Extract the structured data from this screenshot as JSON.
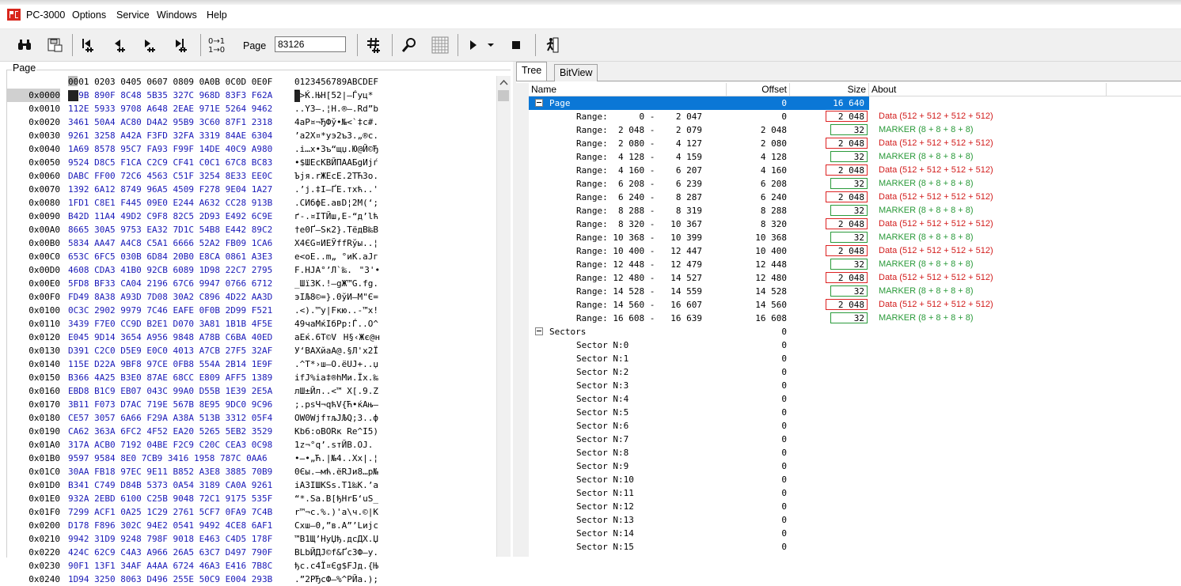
{
  "app": {
    "title": "PC-3000"
  },
  "menu": [
    "Options",
    "Service",
    "Windows",
    "Help"
  ],
  "toolbar": {
    "page_label": "Page",
    "page_value": "83126",
    "icons": [
      "binoculars-icon",
      "save-icon",
      "first-page-icon",
      "prev-page-icon",
      "next-page-icon",
      "last-page-icon",
      "swap-bits-icon",
      "page-number-field",
      "hash-icon",
      "magnifier-icon",
      "grid-icon",
      "play-icon",
      "dropdown-arrow-icon",
      "stop-icon",
      "exit-icon"
    ]
  },
  "hex": {
    "group_label": "Page",
    "header_hex": "0001 0203 0405 0607 0809 0A0B 0C0D 0E0F",
    "header_ascii": "0123456789ABCDEF",
    "rows": [
      {
        "addr": "0x0000",
        "hex": "E59B 890F 8C48 5B35 327C 968D 83F3 F62A",
        "ascii": "█>Ќ.ЊН[52|–Ѓуц*"
      },
      {
        "addr": "0x0010",
        "hex": "112E 5933 9708 A648 2EAE 971E 5264 9462",
        "ascii": "..Y3—.¦H.®—.Rd”b"
      },
      {
        "addr": "0x0020",
        "hex": "3461 50A4 AC80 D4A2 95B9 3C60 87F1 2318",
        "ascii": "4aP¤¬ЂФў•№<`‡с#."
      },
      {
        "addr": "0x0030",
        "hex": "9261 3258 A42A F3FD 32FA 3319 84AE 6304",
        "ascii": "’a2X¤*уэ2ъ3.„®c."
      },
      {
        "addr": "0x0040",
        "hex": "1A69 8578 95C7 FA93 F99F 14DE 40C9 A980",
        "ascii": ".i…x•Зъ“щџ.Ю@Й©Ђ"
      },
      {
        "addr": "0x0050",
        "hex": "9524 D8C5 F1CA C2C9 CF41 C0C1 67C8 BC83",
        "ascii": "•$ШЕсКВЙПААБgИјѓ"
      },
      {
        "addr": "0x0060",
        "hex": "DABC FF00 72C6 4563 C51F 3254 8E33 EE0C",
        "ascii": "Ъјя.rЖEcЕ.2TЋ3о."
      },
      {
        "addr": "0x0070",
        "hex": "1392 6A12 8749 96A5 4509 F278 9E04 1A27",
        "ascii": ".’j.‡I–ҐE.тxћ..'"
      },
      {
        "addr": "0x0080",
        "hex": "1FD1 C8E1 F445 09E0 E244 A632 CC28 913B",
        "ascii": ".СИбфE.авD¦2М(‘;"
      },
      {
        "addr": "0x0090",
        "hex": "B42D 11A4 49D2 C9F8 82C5 2D93 E492 6C9E",
        "ascii": "ґ-.¤IТЙш‚Е-“д’lћ"
      },
      {
        "addr": "0x00A0",
        "hex": "8665 30A5 9753 EA32 7D1C 54B8 E442 89C2",
        "ascii": "†e0Ґ—Sк2}.TёдB‰В"
      },
      {
        "addr": "0x00B0",
        "hex": "5834 AA47 A4C8 C5A1 6666 52A2 FB09 1CA6",
        "ascii": "X4ЄG¤ИЕЎffRўы..¦"
      },
      {
        "addr": "0x00C0",
        "hex": "653C 6FC5 030B 6D84 20B0 E8CA 0861 A3E3",
        "ascii": "e<oЕ..m„ °иК.aЈг"
      },
      {
        "addr": "0x00D0",
        "hex": "4608 CDA3 41B0 92CB 6089 1D98 22C7 2795",
        "ascii": "F.НЈA°’Л`‰.\"З'•"
      },
      {
        "addr": "0x00E0",
        "hex": "5FD8 BF33 CA04 2196 67C6 9947 0766 6712",
        "ascii": "_Шї3К.!–gЖ™G.fg."
      },
      {
        "addr": "0x00F0",
        "hex": "FD49 8A38 A93D 7D08 30A2 C896 4D22 AA3D",
        "ascii": "эIЉ8©=}.0ўИ–M\"Є="
      },
      {
        "addr": "0x0100",
        "hex": "0C3C 2902 9979 7C46 EAFE 0F0B 2D99 F521",
        "ascii": ".<).™y|Fкю..-™х!"
      },
      {
        "addr": "0x0110",
        "hex": "3439 F7E0 CC9D B2E1 D070 3A81 1B1B 4F5E",
        "ascii": "49чаМќІбРp:Ѓ..O^"
      },
      {
        "addr": "0x0120",
        "hex": "E045 9D14 3654 A956 9848 A78B C6BA 40ED",
        "ascii": "аEќ.6T©VH§‹Жє@н"
      },
      {
        "addr": "0x0130",
        "hex": "D391 C2C0 D5E9 E0C0 4013 A7CB 27F5 32AF",
        "ascii": "У‘ВАХйаА@.§Л'х2Ї"
      },
      {
        "addr": "0x0140",
        "hex": "115E D22A 9BF8 97CE 0FB8 554A 2B14 1E9F",
        "ascii": ".^Т*›ш—О.ёUJ+..џ"
      },
      {
        "addr": "0x0150",
        "hex": "B366 4A25 B3E0 87AE 68CC E809 AFF5 1389",
        "ascii": "іfJ%іа‡®hМи.Їх.‰"
      },
      {
        "addr": "0x0160",
        "hex": "EBD8 B1C9 EB07 043C 99A0 D55B 1E39 2E5A",
        "ascii": "лШ±Йл..<™ Х[.9.Z"
      },
      {
        "addr": "0x0170",
        "hex": "3B11 F073 D7AC 719E 567B 8E95 9DC0 9C96",
        "ascii": ";.psЧ¬qћV{Ћ•ќАњ–"
      },
      {
        "addr": "0x0180",
        "hex": "CE57 3057 6A66 F29A A38A 513B 3312 05F4",
        "ascii": "ОW0WjfтљЈЉQ;3..ф"
      },
      {
        "addr": "0x0190",
        "hex": "CA62 363A 6FC2 4F52 EA20 5265 5EB2 3529",
        "ascii": "Кb6:oВORк Re^І5)"
      },
      {
        "addr": "0x01A0",
        "hex": "317A ACB0 7192 04BE F2C9 C20C CEA3 0C98",
        "ascii": "1z¬°q’.sтЙВ.ОЈ."
      },
      {
        "addr": "0x01B0",
        "hex": "9597 9584 8E0 7CB9 3416 1958 787C 0AA6",
        "ascii": "•—•„Ћ.|№4..Xx|.¦"
      },
      {
        "addr": "0x01C0",
        "hex": "30AA FB18 97EC 9E11 B852 A3E8 3885 70B9",
        "ascii": "0Єы.—мћ.ёRЈи8…p№"
      },
      {
        "addr": "0x01D0",
        "hex": "B341 C749 D84B 5373 0A54 3189 CA0A 9261",
        "ascii": "іAЗIШKSs.T1‰К.’a"
      },
      {
        "addr": "0x01E0",
        "hex": "932A 2EBD 6100 C25B 9048 72C1 9175 535F",
        "ascii": "“*.Ѕa.В[ђHrБ‘uS_"
      },
      {
        "addr": "0x01F0",
        "hex": "7299 ACF1 0A25 1C29 2761 5CF7 0FA9 7C4B",
        "ascii": "r™¬с.%.)'a\\ч.©|K"
      },
      {
        "addr": "0x0200",
        "hex": "D178 F896 302C 94E2 0541 9492 4CE8 6AF1",
        "ascii": "Сxш–0,”в.A”’Lијс"
      },
      {
        "addr": "0x0210",
        "hex": "9942 31D9 9248 798F 9018 E463 C4D5 178F",
        "ascii": "™B1Щ’HyЏђ.дcДХ.Џ"
      },
      {
        "addr": "0x0220",
        "hex": "424C 62C9 C4A3 A966 26A5 63C7 D497 790F",
        "ascii": "BLbЙДЈ©f&ҐcЗФ—y."
      },
      {
        "addr": "0x0230",
        "hex": "90F1 13F1 34AF A4AA 6724 46A3 E416 7B8C",
        "ascii": "ђс.с4Ї¤Єg$FЈд.{Њ"
      },
      {
        "addr": "0x0240",
        "hex": "1D94 3250 8063 D496 255E 50C9 E004 293B",
        "ascii": ".”2PЂcФ–%^PЙа.);"
      }
    ]
  },
  "tabs": [
    "Tree",
    "BitView"
  ],
  "tree": {
    "columns": [
      "Name",
      "Offset",
      "Size",
      "About"
    ],
    "rows": [
      {
        "name": "Page",
        "level": 0,
        "expander": true,
        "offset": "0",
        "size": "16 640",
        "about": "",
        "selected": true
      },
      {
        "name": "Range:      0 -    2 047",
        "level": 1,
        "offset": "0",
        "size": "2 048",
        "about": "Data (512 + 512 + 512 + 512)",
        "kind": "data"
      },
      {
        "name": "Range:  2 048 -    2 079",
        "level": 1,
        "offset": "2 048",
        "size": "32",
        "about": "MARKER (8 + 8 + 8 + 8)",
        "kind": "marker"
      },
      {
        "name": "Range:  2 080 -    4 127",
        "level": 1,
        "offset": "2 080",
        "size": "2 048",
        "about": "Data (512 + 512 + 512 + 512)",
        "kind": "data"
      },
      {
        "name": "Range:  4 128 -    4 159",
        "level": 1,
        "offset": "4 128",
        "size": "32",
        "about": "MARKER (8 + 8 + 8 + 8)",
        "kind": "marker"
      },
      {
        "name": "Range:  4 160 -    6 207",
        "level": 1,
        "offset": "4 160",
        "size": "2 048",
        "about": "Data (512 + 512 + 512 + 512)",
        "kind": "data"
      },
      {
        "name": "Range:  6 208 -    6 239",
        "level": 1,
        "offset": "6 208",
        "size": "32",
        "about": "MARKER (8 + 8 + 8 + 8)",
        "kind": "marker"
      },
      {
        "name": "Range:  6 240 -    8 287",
        "level": 1,
        "offset": "6 240",
        "size": "2 048",
        "about": "Data (512 + 512 + 512 + 512)",
        "kind": "data"
      },
      {
        "name": "Range:  8 288 -    8 319",
        "level": 1,
        "offset": "8 288",
        "size": "32",
        "about": "MARKER (8 + 8 + 8 + 8)",
        "kind": "marker"
      },
      {
        "name": "Range:  8 320 -   10 367",
        "level": 1,
        "offset": "8 320",
        "size": "2 048",
        "about": "Data (512 + 512 + 512 + 512)",
        "kind": "data"
      },
      {
        "name": "Range: 10 368 -   10 399",
        "level": 1,
        "offset": "10 368",
        "size": "32",
        "about": "MARKER (8 + 8 + 8 + 8)",
        "kind": "marker"
      },
      {
        "name": "Range: 10 400 -   12 447",
        "level": 1,
        "offset": "10 400",
        "size": "2 048",
        "about": "Data (512 + 512 + 512 + 512)",
        "kind": "data"
      },
      {
        "name": "Range: 12 448 -   12 479",
        "level": 1,
        "offset": "12 448",
        "size": "32",
        "about": "MARKER (8 + 8 + 8 + 8)",
        "kind": "marker"
      },
      {
        "name": "Range: 12 480 -   14 527",
        "level": 1,
        "offset": "12 480",
        "size": "2 048",
        "about": "Data (512 + 512 + 512 + 512)",
        "kind": "data"
      },
      {
        "name": "Range: 14 528 -   14 559",
        "level": 1,
        "offset": "14 528",
        "size": "32",
        "about": "MARKER (8 + 8 + 8 + 8)",
        "kind": "marker"
      },
      {
        "name": "Range: 14 560 -   16 607",
        "level": 1,
        "offset": "14 560",
        "size": "2 048",
        "about": "Data (512 + 512 + 512 + 512)",
        "kind": "data"
      },
      {
        "name": "Range: 16 608 -   16 639",
        "level": 1,
        "offset": "16 608",
        "size": "32",
        "about": "MARKER (8 + 8 + 8 + 8)",
        "kind": "marker"
      },
      {
        "name": "Sectors",
        "level": 0,
        "expander": true,
        "offset": "0",
        "size": "",
        "about": ""
      },
      {
        "name": "Sector N:0",
        "level": 1,
        "offset": "0",
        "size": "",
        "about": ""
      },
      {
        "name": "Sector N:1",
        "level": 1,
        "offset": "0",
        "size": "",
        "about": ""
      },
      {
        "name": "Sector N:2",
        "level": 1,
        "offset": "0",
        "size": "",
        "about": ""
      },
      {
        "name": "Sector N:3",
        "level": 1,
        "offset": "0",
        "size": "",
        "about": ""
      },
      {
        "name": "Sector N:4",
        "level": 1,
        "offset": "0",
        "size": "",
        "about": ""
      },
      {
        "name": "Sector N:5",
        "level": 1,
        "offset": "0",
        "size": "",
        "about": ""
      },
      {
        "name": "Sector N:6",
        "level": 1,
        "offset": "0",
        "size": "",
        "about": ""
      },
      {
        "name": "Sector N:7",
        "level": 1,
        "offset": "0",
        "size": "",
        "about": ""
      },
      {
        "name": "Sector N:8",
        "level": 1,
        "offset": "0",
        "size": "",
        "about": ""
      },
      {
        "name": "Sector N:9",
        "level": 1,
        "offset": "0",
        "size": "",
        "about": ""
      },
      {
        "name": "Sector N:10",
        "level": 1,
        "offset": "0",
        "size": "",
        "about": ""
      },
      {
        "name": "Sector N:11",
        "level": 1,
        "offset": "0",
        "size": "",
        "about": ""
      },
      {
        "name": "Sector N:12",
        "level": 1,
        "offset": "0",
        "size": "",
        "about": ""
      },
      {
        "name": "Sector N:13",
        "level": 1,
        "offset": "0",
        "size": "",
        "about": ""
      },
      {
        "name": "Sector N:14",
        "level": 1,
        "offset": "0",
        "size": "",
        "about": ""
      },
      {
        "name": "Sector N:15",
        "level": 1,
        "offset": "0",
        "size": "",
        "about": ""
      }
    ]
  },
  "colors": {
    "selection": "#0b77d6",
    "data_red": "#d21c1c",
    "marker_green": "#2a9a3a",
    "hex_blue": "#1a1ab8"
  }
}
